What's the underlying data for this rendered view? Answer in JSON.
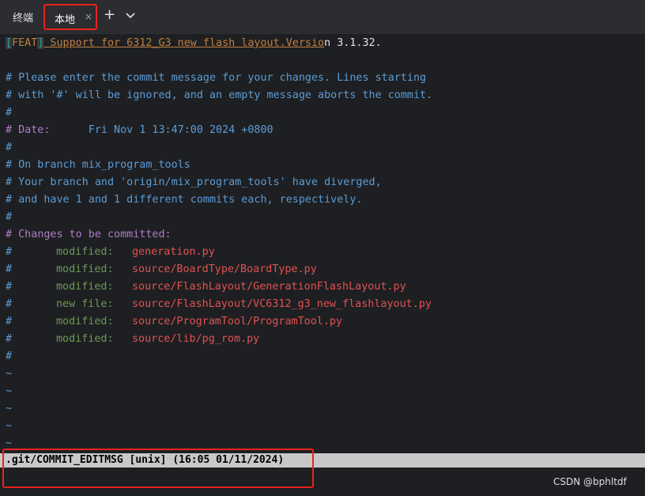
{
  "tabbar": {
    "title": "终端",
    "active_tab": "本地",
    "close_glyph": "×",
    "add_glyph": "+",
    "dropdown_icon": "chevron-down-icon"
  },
  "editor": {
    "header": {
      "open_bracket": "[",
      "tag": "FEAT",
      "close_bracket": "]",
      "summary": " Support for 6312_G3 new flash layout.Versio",
      "summary_tail": "n 3.1.32."
    },
    "intro": [
      "# Please enter the commit message for your changes. Lines starting",
      "# with '#' will be ignored, and an empty message aborts the commit."
    ],
    "hash": "#",
    "date_label": "# Date:",
    "date_value": "      Fri Nov 1 13:47:00 2024 +0800",
    "branch_lines": [
      "# On branch mix_program_tools",
      "# Your branch and 'origin/mix_program_tools' have diverged,",
      "# and have 1 and 1 different commits each, respectively."
    ],
    "changes_header": "# Changes to be committed:",
    "changes": [
      {
        "status": "modified:",
        "file": "generation.py"
      },
      {
        "status": "modified:",
        "file": "source/BoardType/BoardType.py"
      },
      {
        "status": "modified:",
        "file": "source/FlashLayout/GenerationFlashLayout.py"
      },
      {
        "status": "new file:",
        "file": "source/FlashLayout/VC6312_g3_new_flashlayout.py"
      },
      {
        "status": "modified:",
        "file": "source/ProgramTool/ProgramTool.py"
      },
      {
        "status": "modified:",
        "file": "source/lib/pg_rom.py"
      }
    ],
    "tilde": "~"
  },
  "statusbar": {
    "text": ".git/COMMIT_EDITMSG [unix] (16:05 01/11/2024)"
  },
  "watermark": "CSDN @bphltdf",
  "colors": {
    "background": "#1e1f22",
    "comment": "#5c9cd6",
    "keyword_purple": "#b07cc8",
    "modified_green": "#6a9955",
    "filename_red": "#e05252",
    "highlight_red": "#e8231e"
  }
}
